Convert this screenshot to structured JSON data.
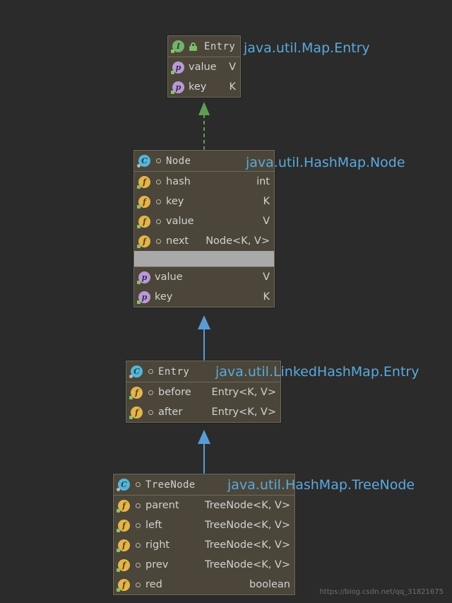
{
  "diagram": {
    "background_color": "#2b2b2b",
    "box_fill_color": "#4b4639",
    "box_border_color": "#6f6a5c",
    "fqn_color": "#5aa9de",
    "implements_arrow_color": "#5f9e52",
    "extends_arrow_color": "#5b9bd5"
  },
  "boxes": {
    "map_entry": {
      "header": {
        "name": "Entry",
        "icon": "interface-icon",
        "visibility_icon": "lock-public-icon"
      },
      "fqn": "java.util.Map.Entry",
      "properties": [
        {
          "icon": "property-icon",
          "name": "value",
          "type": "V"
        },
        {
          "icon": "property-icon",
          "name": "key",
          "type": "K"
        }
      ]
    },
    "hashmap_node": {
      "header": {
        "name": "Node",
        "icon": "class-icon",
        "visibility_icon": "package-private-icon"
      },
      "fqn": "java.util.HashMap.Node",
      "fields": [
        {
          "icon": "field-icon",
          "name": "hash",
          "type": "int"
        },
        {
          "icon": "field-icon",
          "name": "key",
          "type": "K"
        },
        {
          "icon": "field-icon",
          "name": "value",
          "type": "V"
        },
        {
          "icon": "field-icon",
          "name": "next",
          "type": "Node<K, V>"
        }
      ],
      "separator_band": "",
      "properties": [
        {
          "icon": "property-icon",
          "name": "value",
          "type": "V"
        },
        {
          "icon": "property-icon",
          "name": "key",
          "type": "K"
        }
      ]
    },
    "linkedhashmap_entry": {
      "header": {
        "name": "Entry",
        "icon": "class-icon",
        "visibility_icon": "package-private-icon"
      },
      "fqn": "java.util.LinkedHashMap.Entry",
      "fields": [
        {
          "icon": "field-icon",
          "name": "before",
          "type": "Entry<K, V>"
        },
        {
          "icon": "field-icon",
          "name": "after",
          "type": "Entry<K, V>"
        }
      ]
    },
    "hashmap_treenode": {
      "header": {
        "name": "TreeNode",
        "icon": "class-icon",
        "visibility_icon": "package-private-icon"
      },
      "fqn": "java.util.HashMap.TreeNode",
      "fields": [
        {
          "icon": "field-icon",
          "name": "parent",
          "type": "TreeNode<K, V>"
        },
        {
          "icon": "field-icon",
          "name": "left",
          "type": "TreeNode<K, V>"
        },
        {
          "icon": "field-icon",
          "name": "right",
          "type": "TreeNode<K, V>"
        },
        {
          "icon": "field-icon",
          "name": "prev",
          "type": "TreeNode<K, V>"
        },
        {
          "icon": "field-icon",
          "name": "red",
          "type": "boolean"
        }
      ]
    }
  },
  "connectors": [
    {
      "name": "node-implements-map-entry",
      "style": "dashed",
      "color": "#5f9e52"
    },
    {
      "name": "linkedhashmap-entry-extends-node",
      "style": "solid",
      "color": "#5b9bd5"
    },
    {
      "name": "treenode-extends-linkedhashmap-entry",
      "style": "solid",
      "color": "#5b9bd5"
    }
  ],
  "watermark": "https://blog.csdn.net/qq_31821675"
}
